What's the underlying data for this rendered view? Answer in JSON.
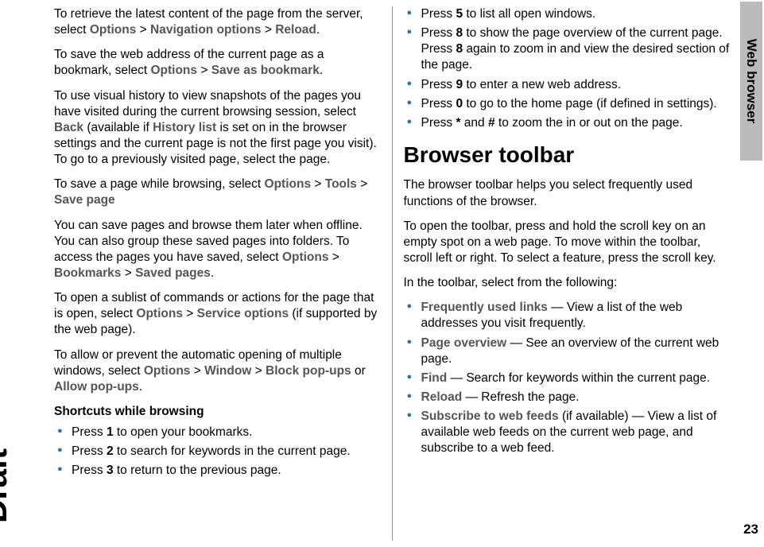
{
  "sideTab": "Web browser",
  "pageNumber": "23",
  "watermark": "Draft",
  "col1": {
    "p1": {
      "pre": "To retrieve the latest content of the page from the server, select ",
      "m1": "Options",
      "s1": " > ",
      "m2": "Navigation options",
      "s2": " > ",
      "m3": "Reload",
      "post": "."
    },
    "p2": {
      "pre": "To save the web address of the current page as a bookmark, select ",
      "m1": "Options",
      "s1": " > ",
      "m2": "Save as bookmark",
      "post": "."
    },
    "p3": {
      "pre": "To use visual history to view snapshots of the pages you have visited during the current browsing session, select ",
      "m1": "Back",
      "mid1": " (available if ",
      "m2": "History list",
      "post": " is set on in the browser settings and the current page is not the first page you visit). To go to a previously visited page, select the page."
    },
    "p4": {
      "pre": "To save a page while browsing, select ",
      "m1": "Options",
      "s1": " > ",
      "m2": "Tools",
      "s2": " > ",
      "m3": "Save page"
    },
    "p5": {
      "pre": "You can save pages and browse them later when offline. You can also group these saved pages into folders. To access the pages you have saved, select ",
      "m1": "Options",
      "s1": " > ",
      "m2": "Bookmarks",
      "s2": " > ",
      "m3": "Saved pages",
      "post": "."
    },
    "p6": {
      "pre": "To open a sublist of commands or actions for the page that is open, select ",
      "m1": "Options",
      "s1": " > ",
      "m2": "Service options",
      "post": " (if supported by the web page)."
    },
    "p7": {
      "pre": "To allow or prevent the automatic opening of multiple windows, select ",
      "m1": "Options",
      "s1": " > ",
      "m2": "Window",
      "s2": " > ",
      "m3": "Block pop-ups",
      "mid": " or ",
      "m4": "Allow pop-ups",
      "post": "."
    },
    "subhead": "Shortcuts while browsing",
    "b1": {
      "pre": "Press ",
      "k": "1",
      "post": " to open your bookmarks."
    },
    "b2": {
      "pre": "Press ",
      "k": "2",
      "post": " to search for keywords in the current page."
    },
    "b3": {
      "pre": "Press ",
      "k": "3",
      "post": " to return to the previous page."
    }
  },
  "col2": {
    "b4": {
      "pre": "Press ",
      "k": "5",
      "post": " to list all open windows."
    },
    "b5": {
      "pre": "Press ",
      "k1": "8",
      "mid": " to show the page overview of the current page. Press ",
      "k2": "8",
      "post": " again to zoom in and view the desired section of the page."
    },
    "b6": {
      "pre": "Press ",
      "k": "9",
      "post": " to enter a new web address."
    },
    "b7": {
      "pre": "Press ",
      "k": "0",
      "post": " to go to the home page (if defined in settings)."
    },
    "b8": {
      "pre": "Press ",
      "k1": "*",
      "mid": " and ",
      "k2": "#",
      "post": " to zoom the in or out on the page."
    },
    "h2": "Browser toolbar",
    "p1": "The browser toolbar helps you select frequently used functions of the browser.",
    "p2": "To open the toolbar, press and hold the scroll key on an empty spot on a web page. To move within the toolbar, scroll left or right. To select a feature, press the scroll key.",
    "p3": "In the toolbar, select from the following:",
    "tb1": {
      "t": "Frequently used links",
      "d": " — View a list of the web addresses you visit frequently."
    },
    "tb2": {
      "t": "Page overview",
      "d": " — See an overview of the current web page."
    },
    "tb3": {
      "t": "Find",
      "d": " — Search for keywords within the current page."
    },
    "tb4": {
      "t": "Reload",
      "d": " — Refresh the page."
    },
    "tb5": {
      "t": "Subscribe to web feeds",
      "d": " (if available) — View a list of available web feeds on the current web page, and subscribe to a web feed."
    }
  }
}
